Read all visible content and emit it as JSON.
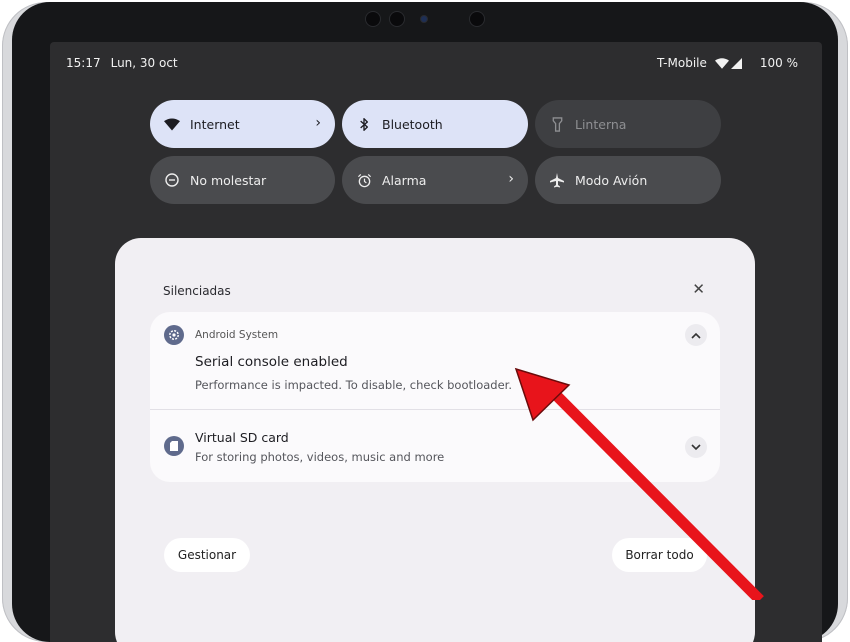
{
  "status_bar": {
    "time": "15:17",
    "date": "Lun, 30 oct",
    "carrier": "T-Mobile",
    "battery": "100 %"
  },
  "quick_tiles": [
    {
      "label": "Internet",
      "icon": "wifi-icon",
      "state": "on",
      "has_chevron": true
    },
    {
      "label": "Bluetooth",
      "icon": "bluetooth-icon",
      "state": "on",
      "has_chevron": false
    },
    {
      "label": "Linterna",
      "icon": "flashlight-icon",
      "state": "unavailable",
      "has_chevron": false
    },
    {
      "label": "No molestar",
      "icon": "do-not-disturb-icon",
      "state": "off",
      "has_chevron": false
    },
    {
      "label": "Alarma",
      "icon": "alarm-icon",
      "state": "off",
      "has_chevron": true
    },
    {
      "label": "Modo Avión",
      "icon": "airplane-icon",
      "state": "off",
      "has_chevron": false
    }
  ],
  "notifications": {
    "section_title": "Silenciadas",
    "items": [
      {
        "app": "Android System",
        "title": "Serial console enabled",
        "text": "Performance is impacted. To disable, check bootloader.",
        "icon": "gear-icon",
        "expanded": true
      },
      {
        "title": "Virtual SD card",
        "text": "For storing photos, videos, music and more",
        "icon": "sd-card-icon",
        "expanded": false
      }
    ],
    "manage_label": "Gestionar",
    "clear_all_label": "Borrar todo"
  },
  "colors": {
    "tile_on": "#dde3f7",
    "tile_off": "#4a4b4e",
    "annotation_arrow": "#e8141b"
  }
}
